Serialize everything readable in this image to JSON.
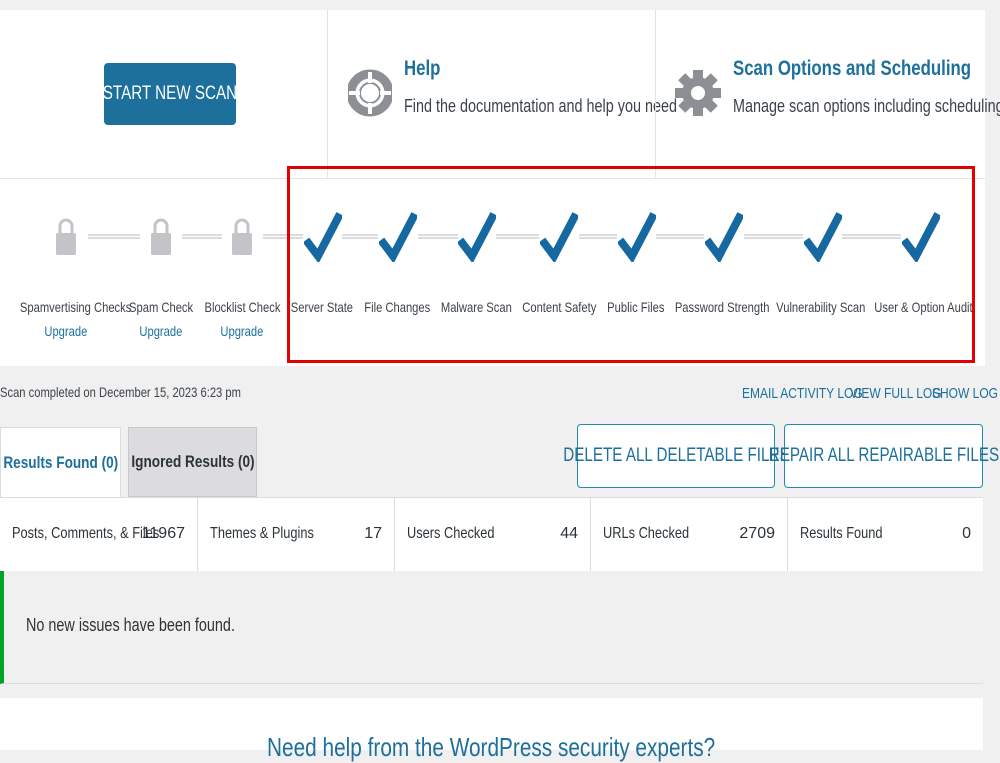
{
  "top": {
    "start_button": "START NEW SCAN",
    "help": {
      "title": "Help",
      "desc": "Find the documentation and help you need",
      "icon": "lifebuoy-icon"
    },
    "scan_options": {
      "title": "Scan Options and Scheduling",
      "desc": "Manage scan options including scheduling",
      "icon": "gear-icon"
    }
  },
  "steps": [
    {
      "label": "Spamvertising Checks",
      "link": "Upgrade",
      "state": "locked"
    },
    {
      "label": "Spam Check",
      "link": "Upgrade",
      "state": "locked"
    },
    {
      "label": "Blocklist Check",
      "link": "Upgrade",
      "state": "locked"
    },
    {
      "label": "Server State",
      "state": "complete"
    },
    {
      "label": "File Changes",
      "state": "complete"
    },
    {
      "label": "Malware Scan",
      "state": "complete"
    },
    {
      "label": "Content Safety",
      "state": "complete"
    },
    {
      "label": "Public Files",
      "state": "complete"
    },
    {
      "label": "Password Strength",
      "state": "complete"
    },
    {
      "label": "Vulnerability Scan",
      "state": "complete"
    },
    {
      "label": "User & Option Audit",
      "state": "complete"
    }
  ],
  "status": {
    "completed_text": "Scan completed on December 15, 2023 6:23 pm",
    "email_log": "EMAIL ACTIVITY LOG",
    "full_log": "VIEW FULL LOG",
    "show_log": "SHOW LOG"
  },
  "tabs": [
    {
      "label": "Results Found (0)",
      "active": true
    },
    {
      "label": "Ignored Results (0)",
      "active": false
    }
  ],
  "actions": {
    "delete": "DELETE ALL DELETABLE FILES",
    "repair": "REPAIR ALL REPAIRABLE FILES"
  },
  "stats": [
    {
      "label": "Posts, Comments, & Files",
      "value": "11967"
    },
    {
      "label": "Themes & Plugins",
      "value": "17"
    },
    {
      "label": "Users Checked",
      "value": "44"
    },
    {
      "label": "URLs Checked",
      "value": "2709"
    },
    {
      "label": "Results Found",
      "value": "0"
    }
  ],
  "notice": "No new issues have been found.",
  "bottom_heading": "Need help from the WordPress security experts?",
  "colors": {
    "accent": "#1d6f9c",
    "check": "#1568a0",
    "highlight": "#e30000",
    "success": "#00a32a",
    "locked": "#c3c4c7"
  }
}
